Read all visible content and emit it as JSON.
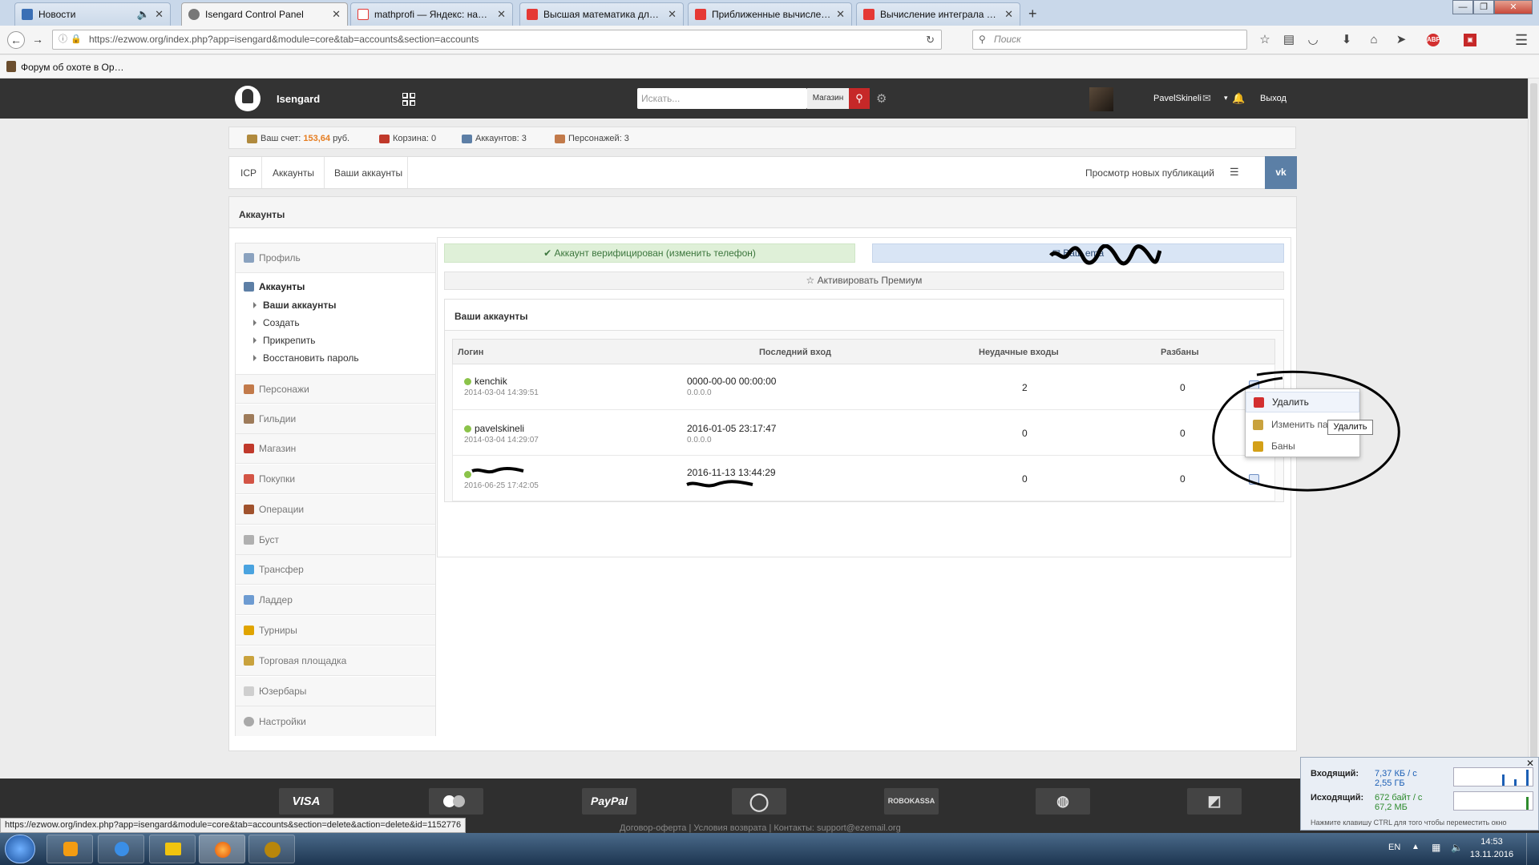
{
  "browser": {
    "tabs": [
      {
        "title": "Новости",
        "color": "#3a6fb5"
      },
      {
        "title": "Isengard Control Panel",
        "color": "#555555"
      },
      {
        "title": "mathprofi — Яндекс: наш…",
        "color": "#e53935"
      },
      {
        "title": "Высшая математика для з…",
        "color": "#e53935"
      },
      {
        "title": "Приближенные вычисле…",
        "color": "#e53935"
      },
      {
        "title": "Вычисление интеграла с …",
        "color": "#e53935"
      }
    ],
    "new_tab": "+",
    "url": "https://ezwow.org/index.php?app=isengard&module=core&tab=accounts&section=accounts",
    "search_placeholder": "Поиск",
    "bookmark": "Форум об охоте в Ор…"
  },
  "site": {
    "brand": "Isengard",
    "search_placeholder": "Искать...",
    "search_scope": "Магазин",
    "username": "PavelSkineli",
    "logout": "Выход"
  },
  "stats": {
    "balance_label": "Ваш счет:",
    "balance_value": "153,64",
    "balance_unit": "руб.",
    "cart": "Корзина: 0",
    "accounts": "Аккаунтов: 3",
    "characters": "Персонажей: 3"
  },
  "breadcrumb": {
    "items": [
      "ICP",
      "Аккаунты",
      "Ваши аккаунты"
    ],
    "new_posts": "Просмотр новых публикаций"
  },
  "section_title": "Аккаунты",
  "sidebar": {
    "profile": "Профиль",
    "accounts": "Аккаунты",
    "sub": [
      "Ваши аккаунты",
      "Создать",
      "Прикрепить",
      "Восстановить пароль"
    ],
    "items": [
      "Персонажи",
      "Гильдии",
      "Магазин",
      "Покупки",
      "Операции",
      "Буст",
      "Трансфер",
      "Ладдер",
      "Турниры",
      "Торговая площадка",
      "Юзербары",
      "Настройки"
    ]
  },
  "notices": {
    "verified": "✔ Аккаунт верифицирован (изменить телефон)",
    "email": "✉ Ваш ema",
    "premium": "☆ Активировать Премиум"
  },
  "accounts_table": {
    "title": "Ваши аккаунты",
    "headers": [
      "Логин",
      "Последний вход",
      "Неудачные входы",
      "Разбаны"
    ],
    "rows": [
      {
        "login": "kenchik",
        "created": "2014-03-04 14:39:51",
        "last_login": "0000-00-00 00:00:00",
        "ip": "0.0.0.0",
        "failed": "2",
        "unbans": "0"
      },
      {
        "login": "pavelskineli",
        "created": "2014-03-04 14:29:07",
        "last_login": "2016-01-05 23:17:47",
        "ip": "0.0.0.0",
        "failed": "0",
        "unbans": "0"
      },
      {
        "login": "",
        "created": "2016-06-25 17:42:05",
        "last_login": "2016-11-13 13:44:29",
        "ip": "",
        "failed": "0",
        "unbans": "0"
      }
    ]
  },
  "dropdown": {
    "items": [
      "Удалить",
      "Изменить па",
      "Баны"
    ],
    "tooltip": "Удалить"
  },
  "footer": {
    "payments": [
      "VISA",
      "",
      "PayPal",
      "",
      "ROBOKASSA",
      "",
      ""
    ],
    "links": "Договор-оферта | Условия возврата | Контакты: support@ezemail.org",
    "status_url": "https://ezwow.org/index.php?app=isengard&module=core&tab=accounts&section=delete&action=delete&id=1152776"
  },
  "netmeter": {
    "in_label": "Входящий:",
    "in_rate": "7,37 КБ / с",
    "in_total": "2,55 ГБ",
    "out_label": "Исходящий:",
    "out_rate": "672 байт / с",
    "out_total": "67,2 МБ",
    "hint": "Нажмите клавишу CTRL для того чтобы переместить окно"
  },
  "taskbar": {
    "lang": "EN",
    "time": "14:53",
    "date": "13.11.2016"
  }
}
